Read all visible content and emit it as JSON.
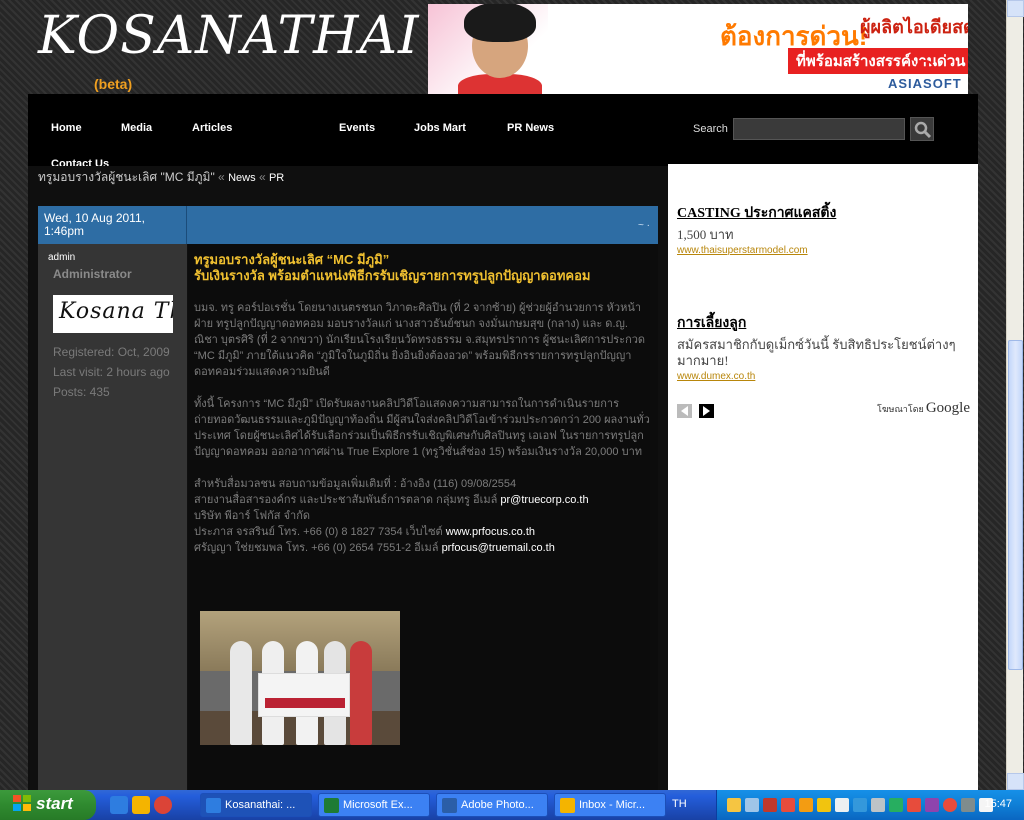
{
  "site": {
    "logo": "KOSANATHAI",
    "beta": "(beta)"
  },
  "banner": {
    "headline": "ต้องการด่วน!",
    "headline_right": "ผู้ผลิตไอเดียสด",
    "subtext": "ที่พร้อมสร้างสรรค์งานด่วน",
    "brand": "ASIASOFT"
  },
  "nav": {
    "items": [
      "Home",
      "Media",
      "Articles",
      "Events",
      "Jobs Mart",
      "PR News",
      "Contact Us"
    ],
    "search_label": "Search",
    "search_value": ""
  },
  "breadcrumb": {
    "title": "ทรูมอบรางวัลผู้ชนะเลิศ \"MC มีภูมิ\"",
    "sep": "«",
    "news": "News",
    "pr": "PR"
  },
  "post": {
    "date": "Wed, 10 Aug 2011, 1:46pm",
    "controls": "~ ·",
    "author": {
      "name": "admin",
      "role": "Administrator",
      "avatar_text": "Kosana Thai",
      "registered": "Registered: Oct, 2009",
      "last_visit": "Last visit: 2 hours ago",
      "posts": "Posts: 435"
    },
    "title_line1": "ทรูมอบรางวัลผู้ชนะเลิศ “MC มีภูมิ”",
    "title_line2": "รับเงินรางวัล พร้อมตำแหน่งพิธีกรรับเชิญรายการทรูปลูกปัญญาดอทคอม",
    "para1": "บมจ. ทรู คอร์ปอเรชั่น โดยนางเนตรชนก วิภาตะศิลปิน (ที่ 2 จากซ้าย) ผู้ช่วยผู้อำนวยการ หัวหน้าฝ่าย ทรูปลูกปัญญาดอทคอม มอบรางวัลแก่ นางสาวธันย์ชนก จงมั่นเกษมสุข (กลาง) และ ด.ญ. ณิชา บุตรศิริ (ที่ 2 จากขวา) นักเรียนโรงเรียนวัดทรงธรรม จ.สมุทรปราการ ผู้ชนะเลิศการประกวด “MC มีภูมิ” ภายใต้แนวคิด “ภูมิใจในภูมิถิ่น ยิ่งอินยิ่งต้องอวด” พร้อมพิธีกรรายการทรูปลูกปัญญาดอทคอมร่วมแสดงความยินดี",
    "para2": "ทั้งนี้ โครงการ “MC มีภูมิ” เปิดรับผลงานคลิปวิดีโอแสดงความสามารถในการดำเนินรายการ ถ่ายทอดวัฒนธรรมและภูมิปัญญาท้องถิ่น มีผู้สนใจส่งคลิปวิดีโอเข้าร่วมประกวดกว่า 200 ผลงานทั่วประเทศ โดยผู้ชนะเลิศได้รับเลือกร่วมเป็นพิธีกรรับเชิญพิเศษกับศิลปินทรู เอเอฟ ในรายการทรูปลูกปัญญาดอทคอม ออกอากาศผ่าน True Explore 1 (ทรูวิชั่นส์ช่อง 15) พร้อมเงินรางวัล 20,000 บาท",
    "contact1": "สำหรับสื่อมวลชน สอบถามข้อมูลเพิ่มเติมที่ : อ้างอิง (116) 09/08/2554",
    "contact2_pre": "สายงานสื่อสารองค์กร และประชาสัมพันธ์การตลาด กลุ่มทรู อีเมล์ ",
    "contact2_mail": "pr@truecorp.co.th",
    "contact3": "บริษัท พีอาร์ โฟกัส จำกัด",
    "contact4_pre": "ประภาส จรสรินย์ โทร. +66 (0) 8 1827 7354 เว็บไซต์ ",
    "contact4_web": "www.prfocus.co.th",
    "contact5_pre": "ศรัญญา ใช่ยชมพล โทร. +66 (0) 2654 7551-2 อีเมล์ ",
    "contact5_mail": "prfocus@truemail.co.th"
  },
  "sidebar": {
    "ads": [
      {
        "title": "CASTING ประกาศแคสติ้ง",
        "text": "1,500 บาท",
        "url": "www.thaisuperstarmodel.com"
      },
      {
        "title": "การเลี้ยงลูก",
        "text": "สมัครสมาชิกกับดูเม็กซ์วันนี้ รับสิทธิประโยชน์ต่างๆ มากมาย!",
        "url": "www.dumex.co.th"
      }
    ],
    "adsby_label": "โฆษณาโดย",
    "adsby_brand": "Google"
  },
  "taskbar": {
    "start": "start",
    "tasks": [
      "Kosanathai: ...",
      "Microsoft Ex...",
      "Adobe Photo...",
      "Inbox - Micr..."
    ],
    "lang": "TH",
    "clock": "15:47"
  },
  "colors": {
    "post_header": "#2e6da4",
    "post_title": "#f0c030",
    "beta": "#f0a020",
    "ad_url": "#b8860b",
    "taskbar": "#245edb",
    "start": "#2f8a2f"
  }
}
